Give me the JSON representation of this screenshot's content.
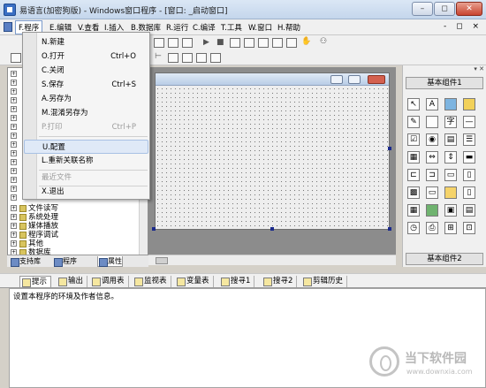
{
  "window": {
    "title": "易语言(加密狗版) - Windows窗口程序 - [窗口: _启动窗口]"
  },
  "menubar": {
    "items": [
      "F.程序",
      "E.编辑",
      "V.查看",
      "I.插入",
      "B.数据库",
      "R.运行",
      "C.编译",
      "T.工具",
      "W.窗口",
      "H.帮助"
    ],
    "mdi_controls": "- ◻ ×"
  },
  "file_menu": {
    "items": [
      {
        "label": "N.新建",
        "shortcut": ""
      },
      {
        "label": "O.打开",
        "shortcut": "Ctrl+O"
      },
      {
        "label": "C.关闭",
        "shortcut": ""
      },
      {
        "label": "S.保存",
        "shortcut": "Ctrl+S"
      },
      {
        "label": "A.另存为",
        "shortcut": ""
      },
      {
        "label": "M.混淆另存为",
        "shortcut": ""
      },
      {
        "label": "P.打印",
        "shortcut": "Ctrl+P"
      },
      {
        "label": "U.配置",
        "shortcut": ""
      },
      {
        "label": "L.重新关联名称",
        "shortcut": ""
      },
      {
        "label": "最近文件",
        "shortcut": ""
      },
      {
        "label": "X.退出",
        "shortcut": ""
      }
    ]
  },
  "left_tree": {
    "items": [
      "文件读写",
      "系统处理",
      "媒体播放",
      "程序调试",
      "其他",
      "数据库"
    ]
  },
  "left_tabs": [
    "支持库",
    "程序",
    "属性"
  ],
  "right_panel": {
    "section1": "基本组件1",
    "section2": "基本组件2",
    "header_glyph": "▾ ✕"
  },
  "bottom_tabs": [
    "提示",
    "输出",
    "调用表",
    "监视表",
    "变量表",
    "搜寻1",
    "搜寻2",
    "剪辑历史"
  ],
  "bottom_panel": {
    "text": "设置本程序的环境及作者信息。"
  },
  "watermark": {
    "name": "当下软件园",
    "url": "www.downxia.com"
  }
}
